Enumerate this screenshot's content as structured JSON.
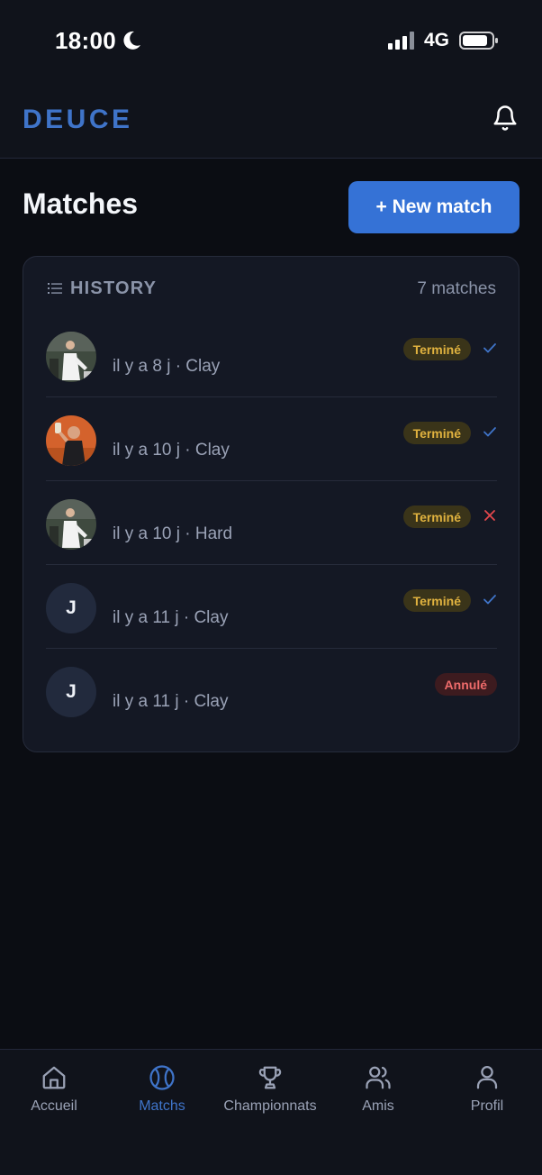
{
  "status_bar": {
    "time": "18:00",
    "network": "4G"
  },
  "header": {
    "logo": "DEUCE"
  },
  "page": {
    "title": "Matches",
    "new_match_label": "+ New match"
  },
  "history": {
    "title": "HISTORY",
    "count": "7 matches",
    "rows": [
      {
        "meta": "il y a 8 j · Clay",
        "status": "Terminé",
        "result": "win"
      },
      {
        "meta": "il y a 10 j · Clay",
        "status": "Terminé",
        "result": "win"
      },
      {
        "meta": "il y a 10 j · Hard",
        "status": "Terminé",
        "result": "loss"
      },
      {
        "avatar_initial": "J",
        "meta": "il y a 11 j · Clay",
        "status": "Terminé",
        "result": "win"
      },
      {
        "avatar_initial": "J",
        "meta": "il y a 11 j · Clay",
        "status": "Annulé"
      }
    ]
  },
  "nav": {
    "items": [
      {
        "label": "Accueil",
        "icon": "home-icon"
      },
      {
        "label": "Matchs",
        "icon": "tennis-ball-icon",
        "active": true
      },
      {
        "label": "Championnats",
        "icon": "trophy-icon"
      },
      {
        "label": "Amis",
        "icon": "users-icon"
      },
      {
        "label": "Profil",
        "icon": "user-icon"
      }
    ]
  },
  "colors": {
    "accent": "#3572d6",
    "background": "#0b0d13",
    "card": "#141824",
    "done_badge": "#e0b23f",
    "cancelled_badge": "#ee6b6b",
    "loss": "#e5484d"
  }
}
